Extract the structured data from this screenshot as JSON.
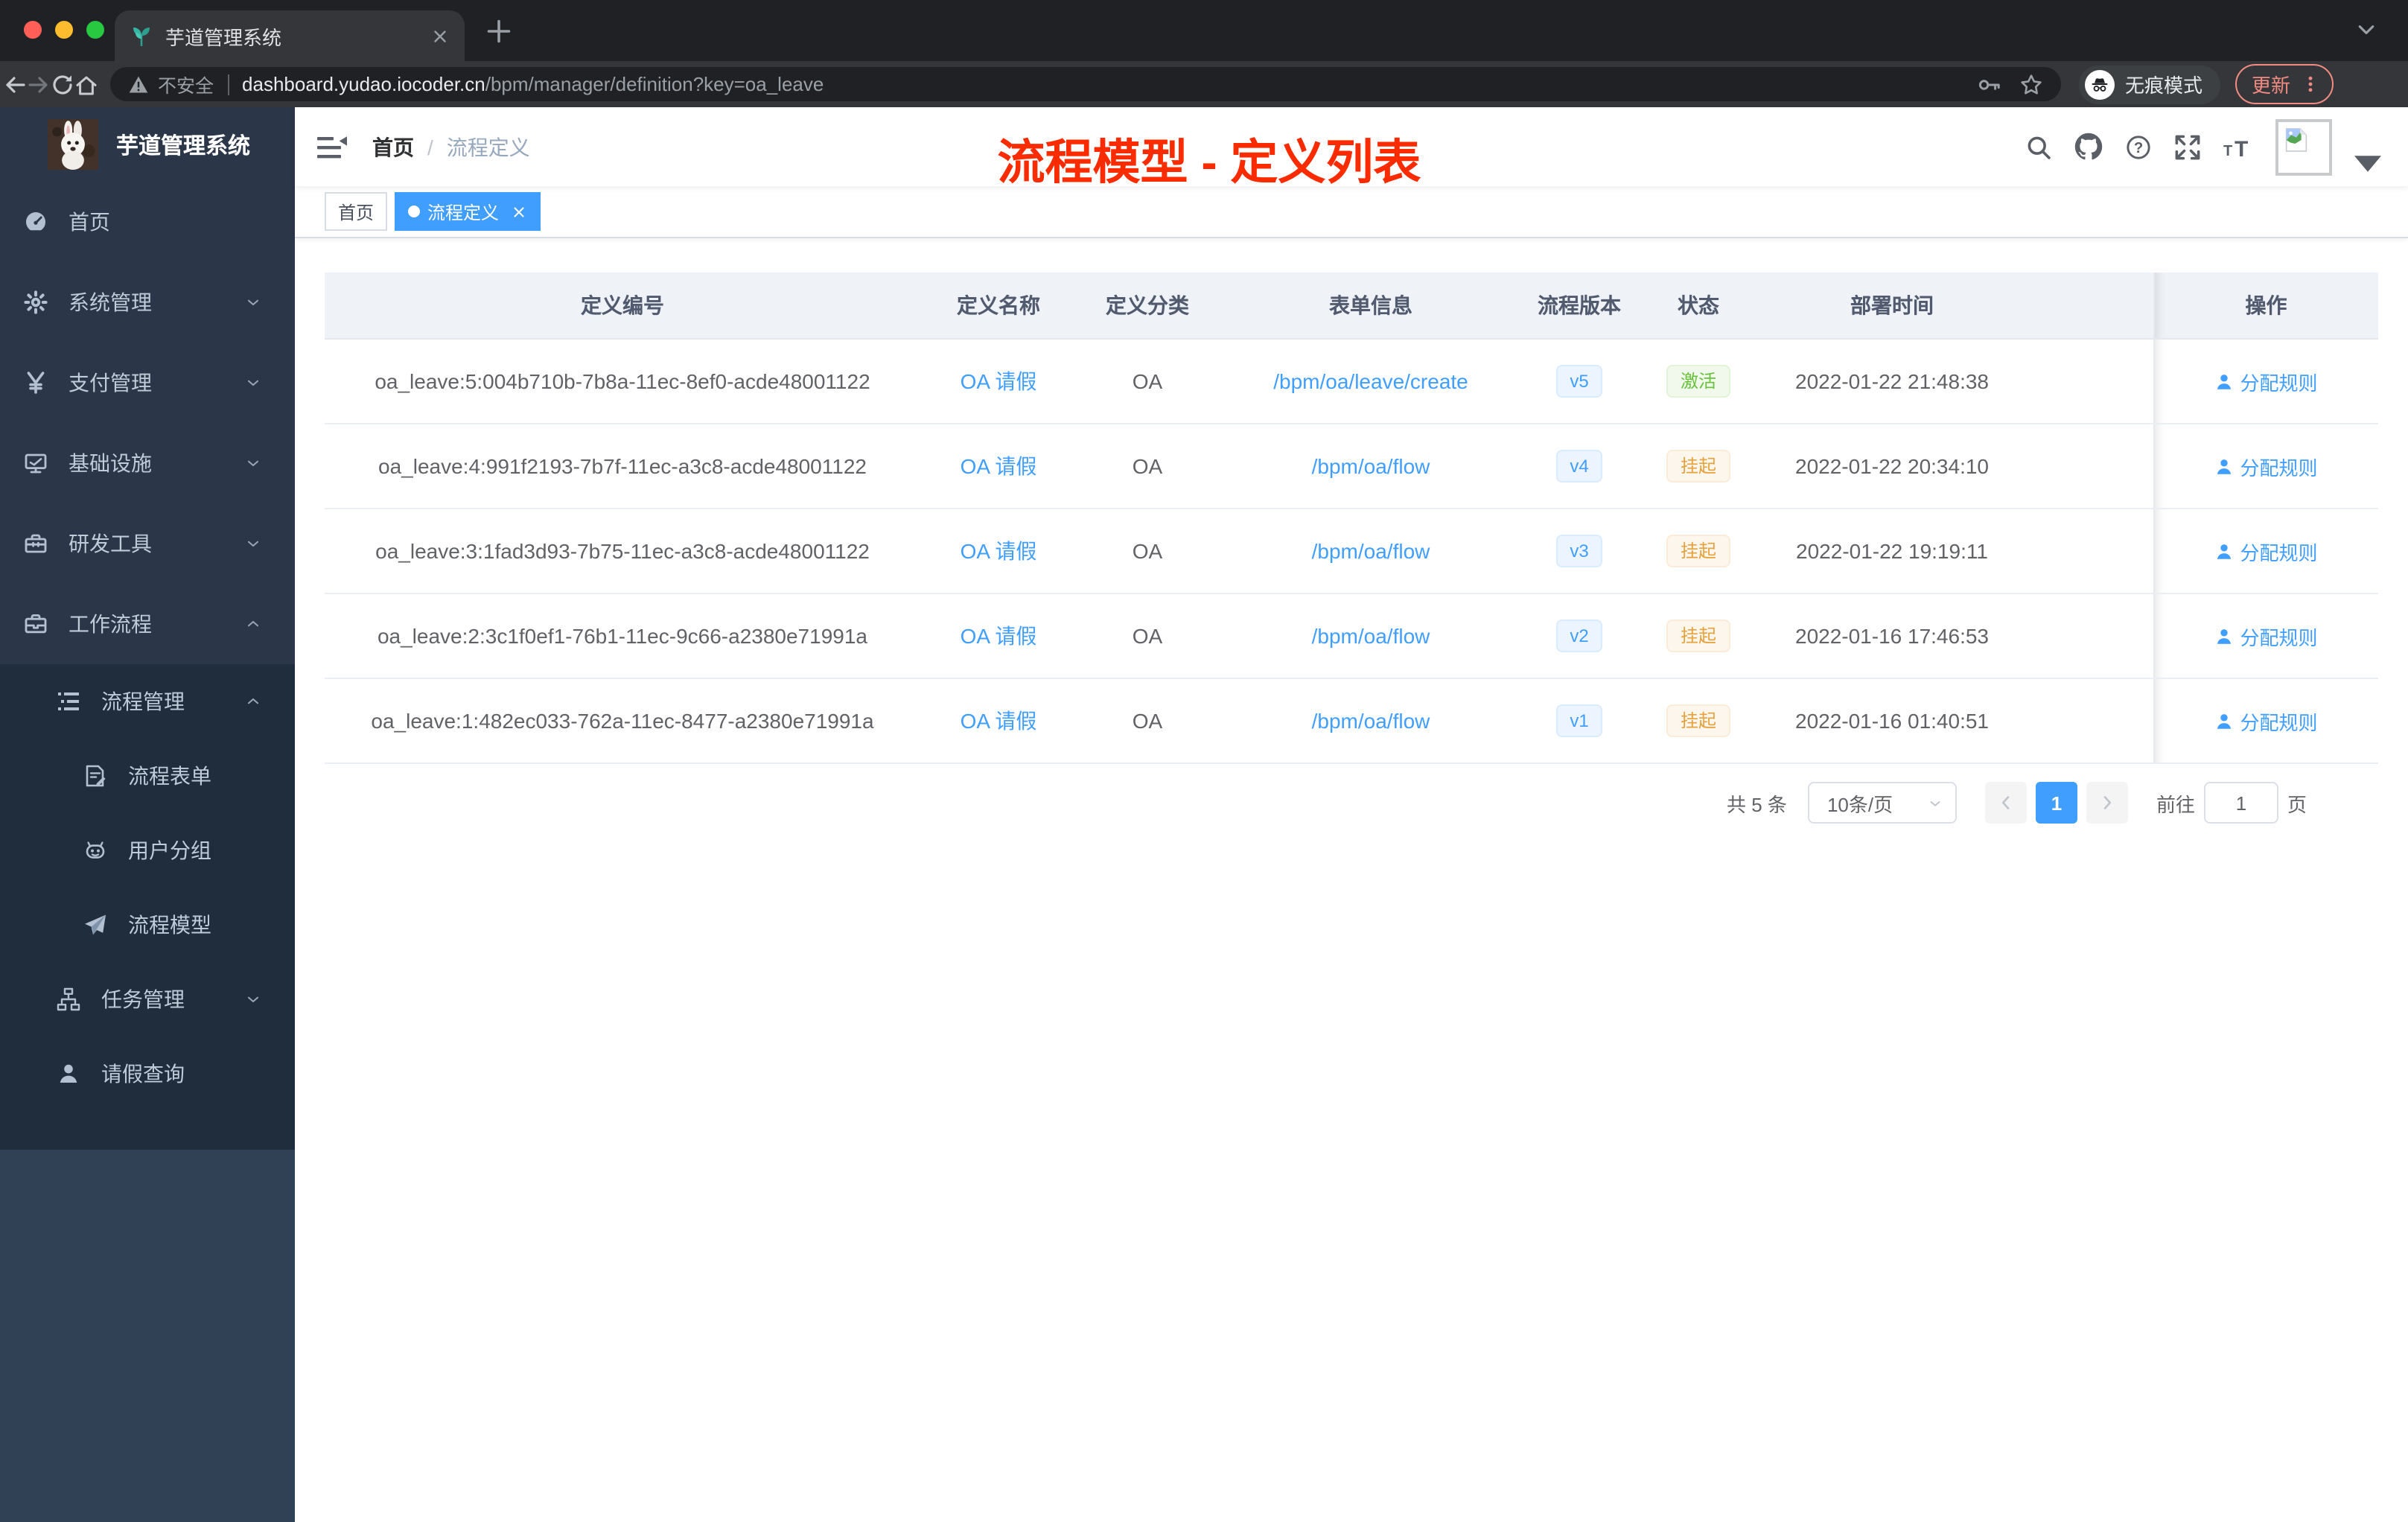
{
  "browser": {
    "tab_title": "芋道管理系统",
    "security_label": "不安全",
    "url_domain": "dashboard.yudao.iocoder.cn",
    "url_path": "/bpm/manager/definition?key=oa_leave",
    "incognito_label": "无痕模式",
    "update_label": "更新"
  },
  "sidebar": {
    "title": "芋道管理系统",
    "menu": [
      {
        "icon": "dashboard-icon",
        "label": "首页",
        "level": 1
      },
      {
        "icon": "gear-icon",
        "label": "系统管理",
        "level": 1,
        "chevron": "down"
      },
      {
        "icon": "yen-icon",
        "label": "支付管理",
        "level": 1,
        "chevron": "down"
      },
      {
        "icon": "monitor-icon",
        "label": "基础设施",
        "level": 1,
        "chevron": "down"
      },
      {
        "icon": "toolbox-icon",
        "label": "研发工具",
        "level": 1,
        "chevron": "down"
      },
      {
        "icon": "briefcase-icon",
        "label": "工作流程",
        "level": 1,
        "chevron": "up"
      },
      {
        "nested": true,
        "items": [
          {
            "icon": "list-icon",
            "label": "流程管理",
            "level": 2,
            "chevron": "up"
          },
          {
            "icon": "form-icon",
            "label": "流程表单",
            "level": 3
          },
          {
            "icon": "robot-icon",
            "label": "用户分组",
            "level": 3
          },
          {
            "icon": "paper-plane-icon",
            "label": "流程模型",
            "level": 3
          },
          {
            "icon": "tree-icon",
            "label": "任务管理",
            "level": 2,
            "chevron": "down"
          },
          {
            "icon": "user-icon",
            "label": "请假查询",
            "level": 2
          }
        ]
      }
    ]
  },
  "navbar": {
    "breadcrumb": [
      "首页",
      "流程定义"
    ],
    "breadcrumb_separator": "/",
    "annotation": "流程模型 - 定义列表"
  },
  "tags": [
    {
      "label": "首页",
      "active": false
    },
    {
      "label": "流程定义",
      "active": true
    }
  ],
  "table": {
    "columns": [
      "定义编号",
      "定义名称",
      "定义分类",
      "表单信息",
      "流程版本",
      "状态",
      "部署时间",
      "操作"
    ],
    "action_label": "分配规则",
    "rows": [
      {
        "id": "oa_leave:5:004b710b-7b8a-11ec-8ef0-acde48001122",
        "name": "OA 请假",
        "category": "OA",
        "form": "/bpm/oa/leave/create",
        "version": "v5",
        "status": {
          "label": "激活",
          "type": "success"
        },
        "deployed": "2022-01-22 21:48:38",
        "action": "分配规则"
      },
      {
        "id": "oa_leave:4:991f2193-7b7f-11ec-a3c8-acde48001122",
        "name": "OA 请假",
        "category": "OA",
        "form": "/bpm/oa/flow",
        "version": "v4",
        "status": {
          "label": "挂起",
          "type": "warning"
        },
        "deployed": "2022-01-22 20:34:10",
        "action": "分配规则"
      },
      {
        "id": "oa_leave:3:1fad3d93-7b75-11ec-a3c8-acde48001122",
        "name": "OA 请假",
        "category": "OA",
        "form": "/bpm/oa/flow",
        "version": "v3",
        "status": {
          "label": "挂起",
          "type": "warning"
        },
        "deployed": "2022-01-22 19:19:11",
        "action": "分配规则"
      },
      {
        "id": "oa_leave:2:3c1f0ef1-76b1-11ec-9c66-a2380e71991a",
        "name": "OA 请假",
        "category": "OA",
        "form": "/bpm/oa/flow",
        "version": "v2",
        "status": {
          "label": "挂起",
          "type": "warning"
        },
        "deployed": "2022-01-16 17:46:53",
        "action": "分配规则"
      },
      {
        "id": "oa_leave:1:482ec033-762a-11ec-8477-a2380e71991a",
        "name": "OA 请假",
        "category": "OA",
        "form": "/bpm/oa/flow",
        "version": "v1",
        "status": {
          "label": "挂起",
          "type": "warning"
        },
        "deployed": "2022-01-16 01:40:51",
        "action": "分配规则"
      }
    ]
  },
  "pagination": {
    "total": "共 5 条",
    "page_size": "10条/页",
    "page": "1",
    "goto_label": "前往",
    "goto_value": "1",
    "unit": "页"
  },
  "colors": {
    "primary": "#409EFF",
    "annotation_red": "#FB2B00",
    "success": "#67C23A",
    "warning": "#E6A23C"
  }
}
